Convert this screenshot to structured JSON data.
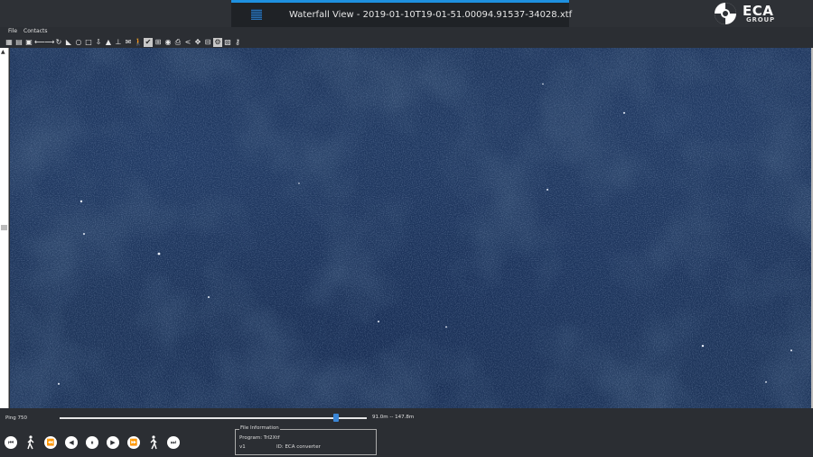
{
  "window": {
    "title": "Waterfall View - 2019-01-10T19-01-51.00094.91537-34028.xtf"
  },
  "logo": {
    "brand": "ECA",
    "sub": "GROUP"
  },
  "menu": [
    "File",
    "Contacts"
  ],
  "toolbar": [
    {
      "icon": "grid-icon",
      "glyph": "▦"
    },
    {
      "icon": "folder-icon",
      "glyph": "▤"
    },
    {
      "icon": "image-icon",
      "glyph": "▣"
    },
    {
      "icon": "arrow-left-icon",
      "glyph": "⟵"
    },
    {
      "icon": "arrow-right-icon",
      "glyph": "⟶"
    },
    {
      "icon": "rotate-icon",
      "glyph": "↻"
    },
    {
      "icon": "triangle-icon",
      "glyph": "◣"
    },
    {
      "icon": "circle-icon",
      "glyph": "○"
    },
    {
      "icon": "square-icon",
      "glyph": "□"
    },
    {
      "icon": "download-icon",
      "glyph": "⇩"
    },
    {
      "icon": "cone-icon",
      "glyph": "▲"
    },
    {
      "icon": "anchor-icon",
      "glyph": "⊥"
    },
    {
      "icon": "mail-icon",
      "glyph": "✉"
    },
    {
      "icon": "walker-icon",
      "glyph": "🚶"
    },
    {
      "icon": "check-icon",
      "glyph": "✔"
    },
    {
      "icon": "chart-icon",
      "glyph": "⊞"
    },
    {
      "icon": "globe-icon",
      "glyph": "◉"
    },
    {
      "icon": "print-icon",
      "glyph": "⎙"
    },
    {
      "icon": "share-icon",
      "glyph": "<"
    },
    {
      "icon": "move-icon",
      "glyph": "✥"
    },
    {
      "icon": "minus-box-icon",
      "glyph": "⊟"
    },
    {
      "icon": "settings-icon",
      "glyph": "⚙"
    },
    {
      "icon": "layers-icon",
      "glyph": "▧"
    },
    {
      "icon": "key-icon",
      "glyph": "⚷"
    }
  ],
  "status": {
    "ping": "Ping 750",
    "range": "91.0m -- 147.8m",
    "slider_position": 0.9
  },
  "controls": [
    "skip-start-icon",
    "walker-back-icon",
    "rewind-icon",
    "play-back-icon",
    "pause-icon",
    "play-icon",
    "fast-forward-icon",
    "walker-forward-icon",
    "skip-end-icon"
  ],
  "file_info": {
    "legend": "File Information",
    "program": "Program: Trl2Xtf",
    "version": "v1",
    "id": "ID: ECA converter"
  },
  "colors": {
    "accent": "#1e90e0",
    "sonar": "#1e355a",
    "background": "#2b2e33"
  }
}
